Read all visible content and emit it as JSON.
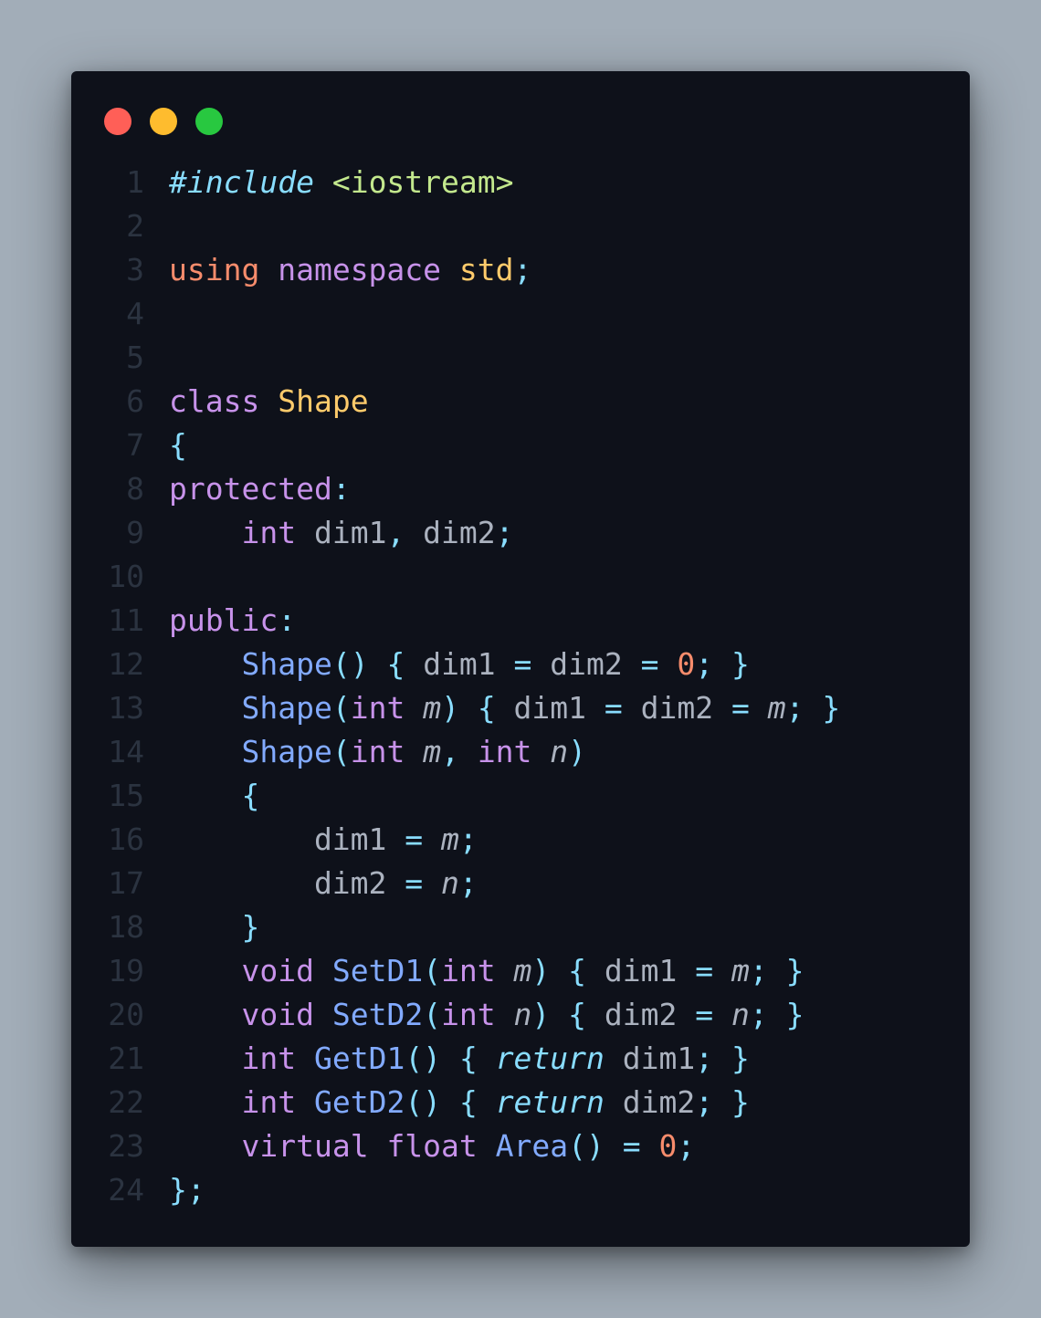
{
  "window": {
    "controls": [
      {
        "name": "close",
        "color": "#ff5f57"
      },
      {
        "name": "minimize",
        "color": "#febc2e"
      },
      {
        "name": "maximize",
        "color": "#28c840"
      }
    ]
  },
  "colors": {
    "preprocessor": "#89ddff",
    "include_path": "#c3e88d",
    "using": "#f78c6c",
    "keyword": "#c792ea",
    "type_name": "#ffcb6b",
    "punctuation": "#89ddff",
    "identifier": "#abb2bf",
    "function": "#82aaff",
    "param": "#abb2bf",
    "number": "#f78c6c",
    "return_kw": "#89ddff",
    "line_number": "#2b3340"
  },
  "code_lines": [
    {
      "number": "1",
      "tokens": [
        {
          "text": "#include",
          "kind": "preprocessor",
          "italic": true
        },
        {
          "text": " ",
          "kind": "identifier"
        },
        {
          "text": "<iostream>",
          "kind": "include_path"
        }
      ]
    },
    {
      "number": "2",
      "tokens": []
    },
    {
      "number": "3",
      "tokens": [
        {
          "text": "using",
          "kind": "using"
        },
        {
          "text": " ",
          "kind": "identifier"
        },
        {
          "text": "namespace",
          "kind": "keyword"
        },
        {
          "text": " ",
          "kind": "identifier"
        },
        {
          "text": "std",
          "kind": "type_name"
        },
        {
          "text": ";",
          "kind": "punctuation"
        }
      ]
    },
    {
      "number": "4",
      "tokens": []
    },
    {
      "number": "5",
      "tokens": []
    },
    {
      "number": "6",
      "tokens": [
        {
          "text": "class",
          "kind": "keyword"
        },
        {
          "text": " ",
          "kind": "identifier"
        },
        {
          "text": "Shape",
          "kind": "type_name"
        }
      ]
    },
    {
      "number": "7",
      "tokens": [
        {
          "text": "{",
          "kind": "punctuation"
        }
      ]
    },
    {
      "number": "8",
      "tokens": [
        {
          "text": "protected",
          "kind": "keyword"
        },
        {
          "text": ":",
          "kind": "punctuation"
        }
      ]
    },
    {
      "number": "9",
      "tokens": [
        {
          "text": "    ",
          "kind": "identifier"
        },
        {
          "text": "int",
          "kind": "keyword"
        },
        {
          "text": " dim1",
          "kind": "identifier"
        },
        {
          "text": ",",
          "kind": "punctuation"
        },
        {
          "text": " dim2",
          "kind": "identifier"
        },
        {
          "text": ";",
          "kind": "punctuation"
        }
      ]
    },
    {
      "number": "10",
      "tokens": []
    },
    {
      "number": "11",
      "tokens": [
        {
          "text": "public",
          "kind": "keyword"
        },
        {
          "text": ":",
          "kind": "punctuation"
        }
      ]
    },
    {
      "number": "12",
      "tokens": [
        {
          "text": "    ",
          "kind": "identifier"
        },
        {
          "text": "Shape",
          "kind": "function"
        },
        {
          "text": "()",
          "kind": "punctuation"
        },
        {
          "text": " ",
          "kind": "identifier"
        },
        {
          "text": "{",
          "kind": "punctuation"
        },
        {
          "text": " dim1 ",
          "kind": "identifier"
        },
        {
          "text": "=",
          "kind": "punctuation"
        },
        {
          "text": " dim2 ",
          "kind": "identifier"
        },
        {
          "text": "=",
          "kind": "punctuation"
        },
        {
          "text": " ",
          "kind": "identifier"
        },
        {
          "text": "0",
          "kind": "number"
        },
        {
          "text": ";",
          "kind": "punctuation"
        },
        {
          "text": " ",
          "kind": "identifier"
        },
        {
          "text": "}",
          "kind": "punctuation"
        }
      ]
    },
    {
      "number": "13",
      "tokens": [
        {
          "text": "    ",
          "kind": "identifier"
        },
        {
          "text": "Shape",
          "kind": "function"
        },
        {
          "text": "(",
          "kind": "punctuation"
        },
        {
          "text": "int",
          "kind": "keyword"
        },
        {
          "text": " ",
          "kind": "identifier"
        },
        {
          "text": "m",
          "kind": "param",
          "italic": true
        },
        {
          "text": ")",
          "kind": "punctuation"
        },
        {
          "text": " ",
          "kind": "identifier"
        },
        {
          "text": "{",
          "kind": "punctuation"
        },
        {
          "text": " dim1 ",
          "kind": "identifier"
        },
        {
          "text": "=",
          "kind": "punctuation"
        },
        {
          "text": " dim2 ",
          "kind": "identifier"
        },
        {
          "text": "=",
          "kind": "punctuation"
        },
        {
          "text": " ",
          "kind": "identifier"
        },
        {
          "text": "m",
          "kind": "param",
          "italic": true
        },
        {
          "text": ";",
          "kind": "punctuation"
        },
        {
          "text": " ",
          "kind": "identifier"
        },
        {
          "text": "}",
          "kind": "punctuation"
        }
      ]
    },
    {
      "number": "14",
      "tokens": [
        {
          "text": "    ",
          "kind": "identifier"
        },
        {
          "text": "Shape",
          "kind": "function"
        },
        {
          "text": "(",
          "kind": "punctuation"
        },
        {
          "text": "int",
          "kind": "keyword"
        },
        {
          "text": " ",
          "kind": "identifier"
        },
        {
          "text": "m",
          "kind": "param",
          "italic": true
        },
        {
          "text": ",",
          "kind": "punctuation"
        },
        {
          "text": " ",
          "kind": "identifier"
        },
        {
          "text": "int",
          "kind": "keyword"
        },
        {
          "text": " ",
          "kind": "identifier"
        },
        {
          "text": "n",
          "kind": "param",
          "italic": true
        },
        {
          "text": ")",
          "kind": "punctuation"
        }
      ]
    },
    {
      "number": "15",
      "tokens": [
        {
          "text": "    ",
          "kind": "identifier"
        },
        {
          "text": "{",
          "kind": "punctuation"
        }
      ]
    },
    {
      "number": "16",
      "tokens": [
        {
          "text": "        dim1 ",
          "kind": "identifier"
        },
        {
          "text": "=",
          "kind": "punctuation"
        },
        {
          "text": " ",
          "kind": "identifier"
        },
        {
          "text": "m",
          "kind": "param",
          "italic": true
        },
        {
          "text": ";",
          "kind": "punctuation"
        }
      ]
    },
    {
      "number": "17",
      "tokens": [
        {
          "text": "        dim2 ",
          "kind": "identifier"
        },
        {
          "text": "=",
          "kind": "punctuation"
        },
        {
          "text": " ",
          "kind": "identifier"
        },
        {
          "text": "n",
          "kind": "param",
          "italic": true
        },
        {
          "text": ";",
          "kind": "punctuation"
        }
      ]
    },
    {
      "number": "18",
      "tokens": [
        {
          "text": "    ",
          "kind": "identifier"
        },
        {
          "text": "}",
          "kind": "punctuation"
        }
      ]
    },
    {
      "number": "19",
      "tokens": [
        {
          "text": "    ",
          "kind": "identifier"
        },
        {
          "text": "void",
          "kind": "keyword"
        },
        {
          "text": " ",
          "kind": "identifier"
        },
        {
          "text": "SetD1",
          "kind": "function"
        },
        {
          "text": "(",
          "kind": "punctuation"
        },
        {
          "text": "int",
          "kind": "keyword"
        },
        {
          "text": " ",
          "kind": "identifier"
        },
        {
          "text": "m",
          "kind": "param",
          "italic": true
        },
        {
          "text": ")",
          "kind": "punctuation"
        },
        {
          "text": " ",
          "kind": "identifier"
        },
        {
          "text": "{",
          "kind": "punctuation"
        },
        {
          "text": " dim1 ",
          "kind": "identifier"
        },
        {
          "text": "=",
          "kind": "punctuation"
        },
        {
          "text": " ",
          "kind": "identifier"
        },
        {
          "text": "m",
          "kind": "param",
          "italic": true
        },
        {
          "text": ";",
          "kind": "punctuation"
        },
        {
          "text": " ",
          "kind": "identifier"
        },
        {
          "text": "}",
          "kind": "punctuation"
        }
      ]
    },
    {
      "number": "20",
      "tokens": [
        {
          "text": "    ",
          "kind": "identifier"
        },
        {
          "text": "void",
          "kind": "keyword"
        },
        {
          "text": " ",
          "kind": "identifier"
        },
        {
          "text": "SetD2",
          "kind": "function"
        },
        {
          "text": "(",
          "kind": "punctuation"
        },
        {
          "text": "int",
          "kind": "keyword"
        },
        {
          "text": " ",
          "kind": "identifier"
        },
        {
          "text": "n",
          "kind": "param",
          "italic": true
        },
        {
          "text": ")",
          "kind": "punctuation"
        },
        {
          "text": " ",
          "kind": "identifier"
        },
        {
          "text": "{",
          "kind": "punctuation"
        },
        {
          "text": " dim2 ",
          "kind": "identifier"
        },
        {
          "text": "=",
          "kind": "punctuation"
        },
        {
          "text": " ",
          "kind": "identifier"
        },
        {
          "text": "n",
          "kind": "param",
          "italic": true
        },
        {
          "text": ";",
          "kind": "punctuation"
        },
        {
          "text": " ",
          "kind": "identifier"
        },
        {
          "text": "}",
          "kind": "punctuation"
        }
      ]
    },
    {
      "number": "21",
      "tokens": [
        {
          "text": "    ",
          "kind": "identifier"
        },
        {
          "text": "int",
          "kind": "keyword"
        },
        {
          "text": " ",
          "kind": "identifier"
        },
        {
          "text": "GetD1",
          "kind": "function"
        },
        {
          "text": "()",
          "kind": "punctuation"
        },
        {
          "text": " ",
          "kind": "identifier"
        },
        {
          "text": "{",
          "kind": "punctuation"
        },
        {
          "text": " ",
          "kind": "identifier"
        },
        {
          "text": "return",
          "kind": "return_kw",
          "italic": true
        },
        {
          "text": " dim1",
          "kind": "identifier"
        },
        {
          "text": ";",
          "kind": "punctuation"
        },
        {
          "text": " ",
          "kind": "identifier"
        },
        {
          "text": "}",
          "kind": "punctuation"
        }
      ]
    },
    {
      "number": "22",
      "tokens": [
        {
          "text": "    ",
          "kind": "identifier"
        },
        {
          "text": "int",
          "kind": "keyword"
        },
        {
          "text": " ",
          "kind": "identifier"
        },
        {
          "text": "GetD2",
          "kind": "function"
        },
        {
          "text": "()",
          "kind": "punctuation"
        },
        {
          "text": " ",
          "kind": "identifier"
        },
        {
          "text": "{",
          "kind": "punctuation"
        },
        {
          "text": " ",
          "kind": "identifier"
        },
        {
          "text": "return",
          "kind": "return_kw",
          "italic": true
        },
        {
          "text": " dim2",
          "kind": "identifier"
        },
        {
          "text": ";",
          "kind": "punctuation"
        },
        {
          "text": " ",
          "kind": "identifier"
        },
        {
          "text": "}",
          "kind": "punctuation"
        }
      ]
    },
    {
      "number": "23",
      "tokens": [
        {
          "text": "    ",
          "kind": "identifier"
        },
        {
          "text": "virtual",
          "kind": "keyword"
        },
        {
          "text": " ",
          "kind": "identifier"
        },
        {
          "text": "float",
          "kind": "keyword"
        },
        {
          "text": " ",
          "kind": "identifier"
        },
        {
          "text": "Area",
          "kind": "function"
        },
        {
          "text": "()",
          "kind": "punctuation"
        },
        {
          "text": " ",
          "kind": "identifier"
        },
        {
          "text": "=",
          "kind": "punctuation"
        },
        {
          "text": " ",
          "kind": "identifier"
        },
        {
          "text": "0",
          "kind": "number"
        },
        {
          "text": ";",
          "kind": "punctuation"
        }
      ]
    },
    {
      "number": "24",
      "tokens": [
        {
          "text": "};",
          "kind": "punctuation"
        }
      ]
    }
  ]
}
